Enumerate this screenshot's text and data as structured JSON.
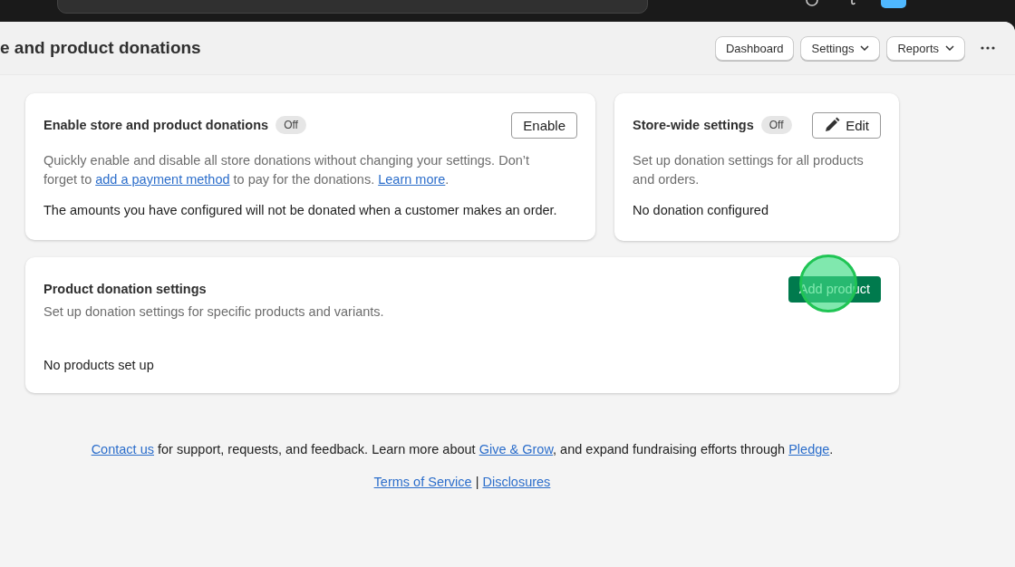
{
  "header": {
    "title": "e and product donations",
    "buttons": [
      {
        "label": "Dashboard",
        "kind": "plain"
      },
      {
        "label": "Settings",
        "kind": "menu"
      },
      {
        "label": "Reports",
        "kind": "menu"
      }
    ]
  },
  "enable_card": {
    "title": "Enable store and product donations",
    "badge": "Off",
    "button": "Enable",
    "description": "Quickly enable and disable all store donations without changing your settings. Don’t forget to ",
    "link1": "add a payment method",
    "middle": " to pay for the donations. ",
    "link2": "Learn more",
    "end": ".",
    "note": "The amounts you have configured will not be donated when a customer makes an order."
  },
  "store_card": {
    "title": "Store-wide settings",
    "badge": "Off",
    "button": "Edit",
    "description": "Set up donation settings for all products and orders.",
    "note": "No donation configured"
  },
  "product_card": {
    "title": "Product donation settings",
    "description": "Set up donation settings for specific products and variants.",
    "button": "Add product",
    "note": "No products set up"
  },
  "footer": {
    "parts": [
      {
        "text": "Contact us",
        "kind": "link"
      },
      {
        "text": " for support, requests, and feedback. Learn more about ",
        "kind": "text"
      },
      {
        "text": "Give & Grow",
        "kind": "link"
      },
      {
        "text": ", and expand fundraising efforts through ",
        "kind": "text"
      },
      {
        "text": "Pledge",
        "kind": "link"
      },
      {
        "text": ".",
        "kind": "text"
      }
    ],
    "links": [
      "Terms of Service",
      "Disclosures"
    ],
    "separator": "|"
  }
}
